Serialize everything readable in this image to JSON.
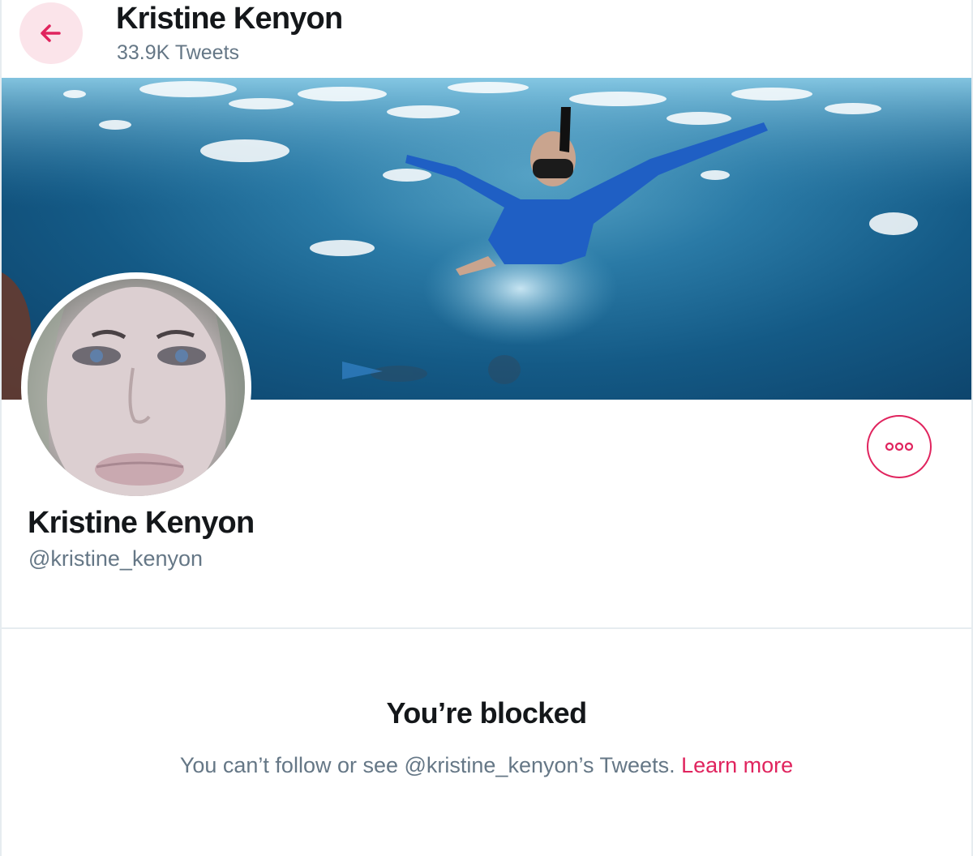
{
  "header": {
    "title": "Kristine Kenyon",
    "tweet_count": "33.9K Tweets"
  },
  "profile": {
    "display_name": "Kristine Kenyon",
    "handle": "@kristine_kenyon"
  },
  "blocked": {
    "title": "You’re blocked",
    "message": "You can’t follow or see @kristine_kenyon’s Tweets.",
    "learn_more": "Learn more"
  },
  "colors": {
    "accent": "#e0245e",
    "secondary_text": "#657786",
    "primary_text": "#14171a",
    "back_button_bg": "#fbe4ea",
    "divider": "#e6ecf0"
  },
  "icons": {
    "back": "back-arrow-icon",
    "more": "more-options-icon"
  }
}
